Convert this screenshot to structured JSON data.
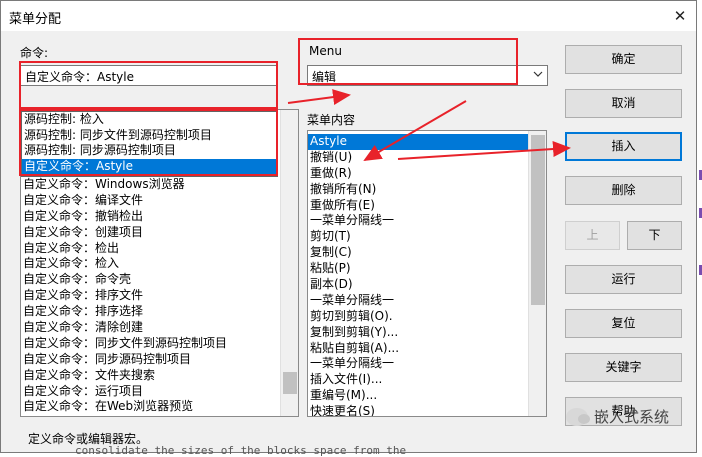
{
  "window": {
    "title": "菜单分配",
    "close_label": "✕"
  },
  "commands": {
    "label": "命令:",
    "current_value": "自定义命令：Astyle",
    "popup_items": [
      "源码控制: 检入",
      "源码控制: 同步文件到源码控制项目",
      "源码控制: 同步源码控制项目",
      "自定义命令：Astyle"
    ],
    "popup_selected": 3,
    "list_items": [
      "自定义命令：Windows浏览器",
      "自定义命令：编译文件",
      "自定义命令：撤销检出",
      "自定义命令：创建项目",
      "自定义命令：检出",
      "自定义命令：检入",
      "自定义命令：命令壳",
      "自定义命令：排序文件",
      "自定义命令：排序选择",
      "自定义命令：清除创建",
      "自定义命令：同步文件到源码控制项目",
      "自定义命令：同步源码控制项目",
      "自定义命令：文件夹搜索",
      "自定义命令：运行项目",
      "自定义命令：在Web浏览器预览"
    ]
  },
  "menu": {
    "label": "Menu",
    "selected": "编辑",
    "dropdown_icon": "chevron-down"
  },
  "menu_content": {
    "label": "菜单内容",
    "items": [
      "Astyle",
      "撤销(U)",
      "重做(R)",
      "撤销所有(N)",
      "重做所有(E)",
      "一菜单分隔线一",
      "剪切(T)",
      "复制(C)",
      "粘贴(P)",
      "副本(D)",
      "一菜单分隔线一",
      "剪切到剪辑(O).",
      "复制到剪辑(Y)...",
      "粘贴自剪辑(A)...",
      "一菜单分隔线一",
      "插入文件(I)...",
      "重编号(M)...",
      "快速更名(S)"
    ],
    "selected_index": 0
  },
  "buttons": {
    "ok": "确定",
    "cancel": "取消",
    "insert": "插入",
    "delete": "删除",
    "up": "上",
    "down": "下",
    "run": "运行",
    "reset": "复位",
    "keys": "关键字",
    "help": "帮助"
  },
  "status": "定义命令或编辑器宏。",
  "background_text": "consolidate the sizes of the blocks space from the",
  "watermark": "嵌入式系统",
  "colors": {
    "selection": "#0078d7",
    "annotation": "#e8222a"
  }
}
